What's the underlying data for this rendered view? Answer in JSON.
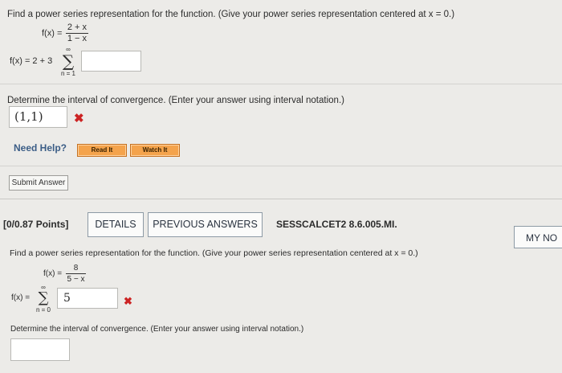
{
  "q1": {
    "prompt": "Find a power series representation for the function. (Give your power series representation centered at x = 0.)",
    "f_lhs": "f(x) =",
    "f_num": "2 + x",
    "f_den": "1 − x",
    "series_lhs": "f(x) = 2 + 3",
    "sigma": "∑",
    "sum_upper": "∞",
    "sum_lower": "n = 1",
    "series_answer": "",
    "interval_prompt": "Determine the interval of convergence. (Enter your answer using interval notation.)",
    "interval_answer": "(1,1)",
    "wrong_mark": "✖"
  },
  "help": {
    "label": "Need Help?",
    "read_it": "Read It",
    "watch_it": "Watch It"
  },
  "submit_label": "Submit Answer",
  "q2": {
    "points": "[0/0.87 Points]",
    "details": "DETAILS",
    "previous_answers": "PREVIOUS ANSWERS",
    "code": "SESSCALCET2 8.6.005.MI.",
    "my_notes": "MY NO",
    "prompt": "Find a power series representation for the function. (Give your power series representation centered at x = 0.)",
    "f_lhs": "f(x) =",
    "f_num": "8",
    "f_den": "5 − x",
    "series_lhs": "f(x) =",
    "sigma": "∑",
    "sum_upper": "∞",
    "sum_lower": "n = 0",
    "series_answer": "5",
    "wrong_mark": "✖",
    "interval_prompt": "Determine the interval of convergence. (Enter your answer using interval notation.)",
    "interval_answer": ""
  },
  "colors": {
    "accent_orange": "#f4a34c",
    "error_red": "#cc2323",
    "help_blue": "#3b5d86"
  }
}
